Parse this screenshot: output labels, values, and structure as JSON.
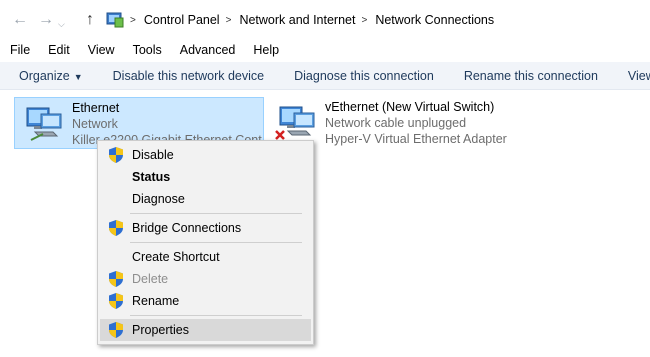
{
  "address_bar": {
    "breadcrumbs": [
      "Control Panel",
      "Network and Internet",
      "Network Connections"
    ],
    "separator": ">"
  },
  "menubar": {
    "items": [
      "File",
      "Edit",
      "View",
      "Tools",
      "Advanced",
      "Help"
    ]
  },
  "command_bar": {
    "organize": "Organize",
    "items": [
      "Disable this network device",
      "Diagnose this connection",
      "Rename this connection",
      "View sta"
    ]
  },
  "connections": [
    {
      "name": "Ethernet",
      "status": "Network",
      "adapter": "Killer e2200 Gigabit Ethernet Cont",
      "selected": true
    },
    {
      "name": "vEthernet (New Virtual Switch)",
      "status": "Network cable unplugged",
      "adapter": "Hyper-V Virtual Ethernet Adapter",
      "selected": false
    }
  ],
  "context_menu": {
    "items": [
      {
        "label": "Disable",
        "icon": "shield-icon"
      },
      {
        "label": "Status",
        "style": "bold"
      },
      {
        "label": "Diagnose"
      },
      {
        "label": "Bridge Connections",
        "icon": "shield-icon"
      },
      {
        "label": "Create Shortcut"
      },
      {
        "label": "Delete",
        "icon": "shield-icon",
        "state": "disabled"
      },
      {
        "label": "Rename",
        "icon": "shield-icon"
      },
      {
        "label": "Properties",
        "icon": "shield-icon",
        "state": "hover"
      }
    ]
  },
  "colors": {
    "selection": "#cce8ff",
    "command_bar": "#f1f4f9",
    "link_text": "#1e395b"
  }
}
